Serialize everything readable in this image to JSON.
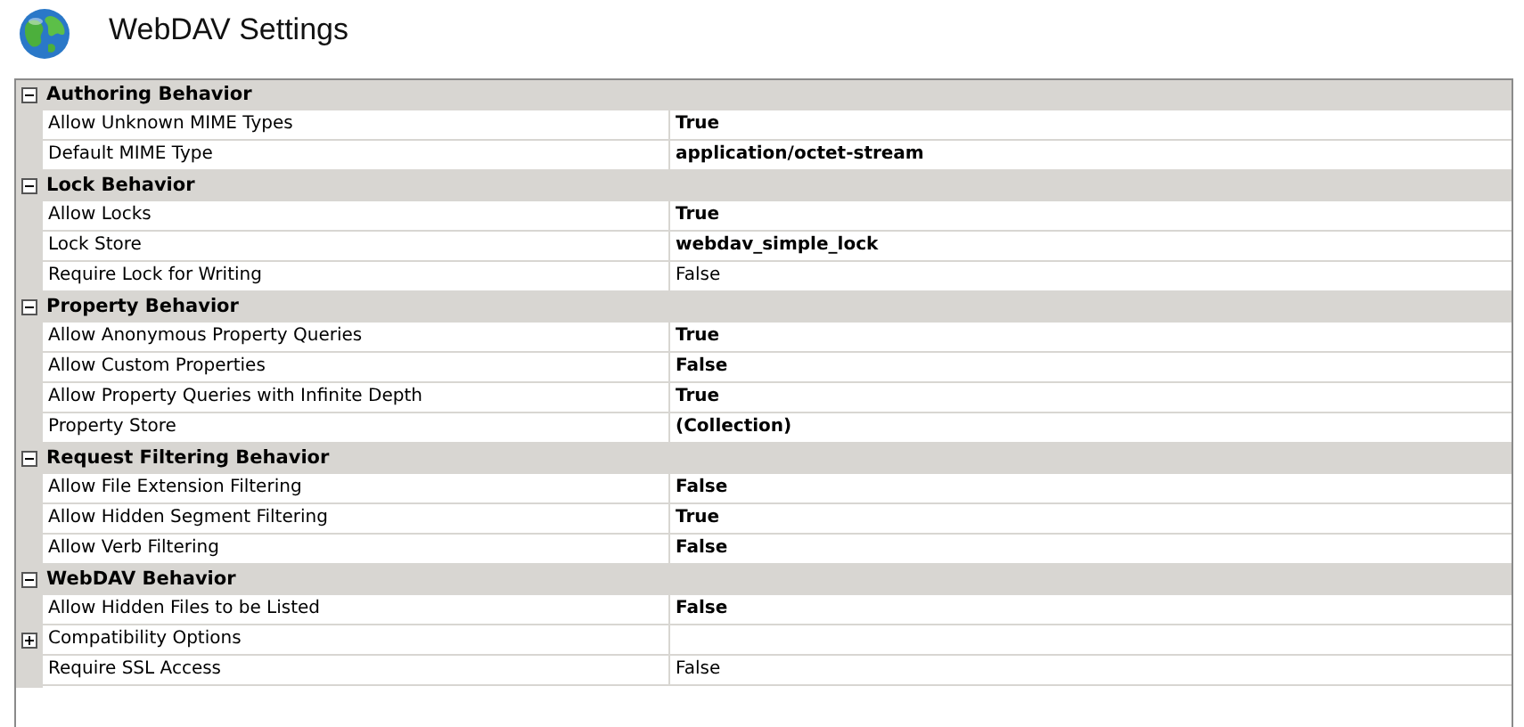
{
  "window": {
    "title": "WebDAV Settings"
  },
  "groups": [
    {
      "name": "Authoring Behavior",
      "expanded": true,
      "rows": [
        {
          "kind": "property",
          "name": "Allow Unknown MIME Types",
          "value": "True",
          "modified": true
        },
        {
          "kind": "property",
          "name": "Default MIME Type",
          "value": "application/octet-stream",
          "modified": true
        }
      ]
    },
    {
      "name": "Lock Behavior",
      "expanded": true,
      "rows": [
        {
          "kind": "property",
          "name": "Allow Locks",
          "value": "True",
          "modified": true
        },
        {
          "kind": "property",
          "name": "Lock Store",
          "value": "webdav_simple_lock",
          "modified": true
        },
        {
          "kind": "property",
          "name": "Require Lock for Writing",
          "value": "False",
          "modified": false
        }
      ]
    },
    {
      "name": "Property Behavior",
      "expanded": true,
      "rows": [
        {
          "kind": "property",
          "name": "Allow Anonymous Property Queries",
          "value": "True",
          "modified": true
        },
        {
          "kind": "property",
          "name": "Allow Custom Properties",
          "value": "False",
          "modified": true
        },
        {
          "kind": "property",
          "name": "Allow Property Queries with Infinite Depth",
          "value": "True",
          "modified": true
        },
        {
          "kind": "property",
          "name": "Property Store",
          "value": "(Collection)",
          "modified": true
        }
      ]
    },
    {
      "name": "Request Filtering Behavior",
      "expanded": true,
      "rows": [
        {
          "kind": "property",
          "name": "Allow File Extension Filtering",
          "value": "False",
          "modified": true
        },
        {
          "kind": "property",
          "name": "Allow Hidden Segment Filtering",
          "value": "True",
          "modified": true
        },
        {
          "kind": "property",
          "name": "Allow Verb Filtering",
          "value": "False",
          "modified": true
        }
      ]
    },
    {
      "name": "WebDAV Behavior",
      "expanded": true,
      "rows": [
        {
          "kind": "property",
          "name": "Allow Hidden Files to be Listed",
          "value": "False",
          "modified": true
        },
        {
          "kind": "subgroup",
          "name": "Compatibility Options",
          "expanded": false
        },
        {
          "kind": "property",
          "name": "Require SSL Access",
          "value": "False",
          "modified": false
        }
      ]
    }
  ]
}
